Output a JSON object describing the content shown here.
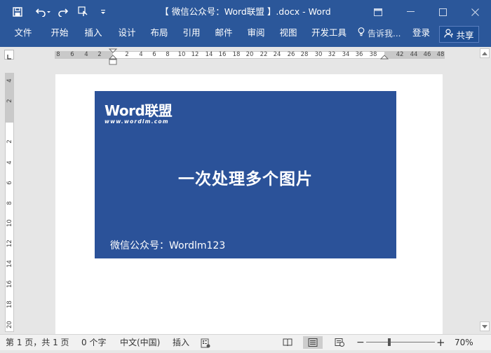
{
  "window": {
    "title": "【 微信公众号：Word联盟 】.docx - Word"
  },
  "quick_access": [
    "save-icon",
    "undo-icon",
    "redo-icon",
    "touch-mode-icon",
    "customize-qat-icon"
  ],
  "ribbon": {
    "tabs": [
      "文件",
      "开始",
      "插入",
      "设计",
      "布局",
      "引用",
      "邮件",
      "审阅",
      "视图",
      "开发工具"
    ],
    "tell_me": "告诉我...",
    "login": "登录",
    "share": "共享"
  },
  "ruler": {
    "h_numbers": [
      "8",
      "6",
      "4",
      "2",
      "2",
      "4",
      "6",
      "8",
      "10",
      "12",
      "14",
      "16",
      "18",
      "20",
      "22",
      "24",
      "26",
      "28",
      "30",
      "32",
      "34",
      "36",
      "38",
      "42",
      "44",
      "46",
      "48"
    ],
    "v_numbers": [
      "4",
      "2",
      "2",
      "4",
      "6",
      "8",
      "10",
      "12",
      "14",
      "16",
      "18",
      "20"
    ]
  },
  "document": {
    "logo_main": "Word联盟",
    "logo_sub": "www.wordlm.com",
    "headline": "一次处理多个图片",
    "footer": "微信公众号：Wordlm123",
    "banner_color": "#2b5299"
  },
  "statusbar": {
    "page": "第 1 页，共 1 页",
    "words": "0 个字",
    "language": "中文(中国)",
    "mode": "插入",
    "zoom": "70%",
    "zoom_minus": "−",
    "zoom_plus": "+"
  },
  "colors": {
    "accent": "#2b579a"
  }
}
